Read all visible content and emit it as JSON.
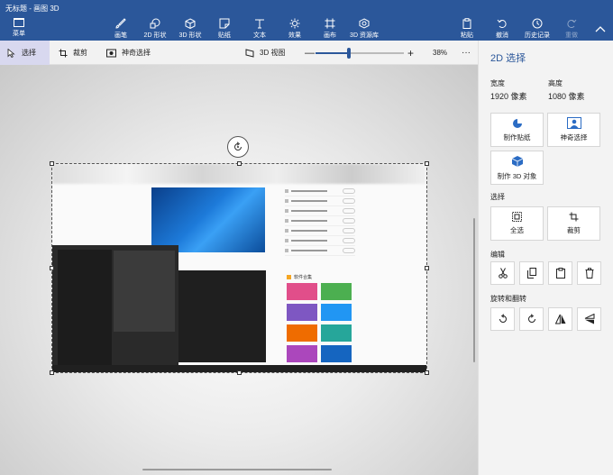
{
  "window": {
    "title": "无标题 - 画图 3D",
    "controls": [
      "—",
      "☐",
      "✕"
    ]
  },
  "toolbar": {
    "menu_label": "菜单",
    "tools": [
      {
        "id": "brushes",
        "label": "画笔",
        "icon": "brush-icon"
      },
      {
        "id": "shapes2d",
        "label": "2D 形状",
        "icon": "shapes-2d-icon"
      },
      {
        "id": "shapes3d",
        "label": "3D 形状",
        "icon": "cube-icon"
      },
      {
        "id": "stickers",
        "label": "贴纸",
        "icon": "sticker-icon"
      },
      {
        "id": "text",
        "label": "文本",
        "icon": "text-icon"
      },
      {
        "id": "effects",
        "label": "效果",
        "icon": "sun-icon"
      },
      {
        "id": "canvas",
        "label": "画布",
        "icon": "canvas-icon"
      },
      {
        "id": "library3d",
        "label": "3D 资源库",
        "icon": "library-icon"
      }
    ],
    "paste_label": "粘贴",
    "undo_label": "撤消",
    "history_label": "历史记录",
    "redo_label": "重做"
  },
  "subbar": {
    "select_label": "选择",
    "crop_label": "裁剪",
    "magic_select_label": "神奇选择",
    "view3d_label": "3D 视图",
    "zoom_out": "—",
    "zoom_in": "+",
    "zoom_value": 0.38,
    "zoom_text": "38%",
    "more": "···"
  },
  "canvas": {
    "image_list_rows": 7,
    "image_software_heading": "软件合集",
    "image_thumbnail_colors": [
      "#e14e8a",
      "#4caf50",
      "#7e57c2",
      "#2196f3",
      "#ef6c00",
      "#26a69a",
      "#ab47bc",
      "#1565c0",
      "#d81b60",
      "#ffb300"
    ]
  },
  "panel": {
    "title": "2D 选择",
    "width_label": "宽度",
    "width_value": "1920 像素",
    "height_label": "高度",
    "height_value": "1080 像素",
    "make_sticker": "制作贴纸",
    "magic_select": "神奇选择",
    "make_3d": "制作 3D 对象",
    "select_section": "选择",
    "select_all": "全选",
    "crop": "裁剪",
    "edit_section": "编辑",
    "rotate_section": "旋转和翻转"
  }
}
